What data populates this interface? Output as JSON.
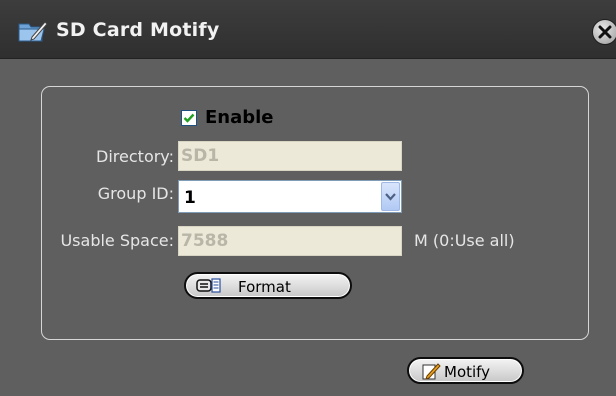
{
  "window": {
    "title": "SD Card Motify",
    "title_icon": "pencil-folder-icon",
    "close_icon": "close-icon"
  },
  "form": {
    "enable": {
      "label": "Enable",
      "checked": true
    },
    "directory": {
      "label": "Directory:",
      "value": "SD1"
    },
    "group_id": {
      "label": "Group ID:",
      "value": "1"
    },
    "usable_space": {
      "label": "Usable Space:",
      "value": "7588",
      "unit_hint": "M (0:Use all)"
    },
    "format_button": {
      "label": "Format",
      "icon": "format-drive-icon"
    }
  },
  "footer": {
    "motify_button": {
      "label": "Motify",
      "icon": "edit-document-icon"
    }
  },
  "colors": {
    "background": "#5f5f5f",
    "titlebar": "#333333",
    "disabled_field": "#ece9d8",
    "checkbox_check": "#21a121"
  }
}
